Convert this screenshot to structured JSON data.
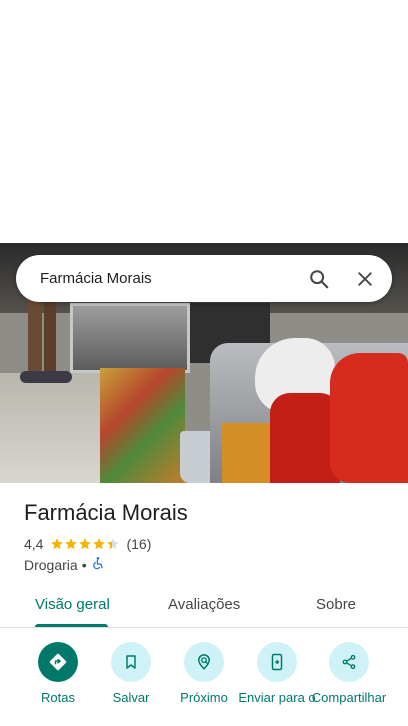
{
  "search": {
    "query": "Farmácia Morais"
  },
  "place": {
    "name": "Farmácia Morais",
    "rating": "4,4",
    "stars": 4.4,
    "review_count": "(16)",
    "category": "Drogaria",
    "separator": "•"
  },
  "tabs": [
    {
      "label": "Visão geral",
      "active": true
    },
    {
      "label": "Avaliações",
      "active": false
    },
    {
      "label": "Sobre",
      "active": false
    }
  ],
  "actions": [
    {
      "label": "Rotas",
      "icon": "directions-icon"
    },
    {
      "label": "Salvar",
      "icon": "bookmark-icon"
    },
    {
      "label": "Próximo",
      "icon": "nearby-icon"
    },
    {
      "label": "Enviar para o",
      "icon": "send-to-phone-icon"
    },
    {
      "label": "Compartilhar",
      "icon": "share-icon"
    }
  ],
  "colors": {
    "accent": "#00796b",
    "action_bg": "#cff2f7",
    "star": "#f4b400"
  }
}
